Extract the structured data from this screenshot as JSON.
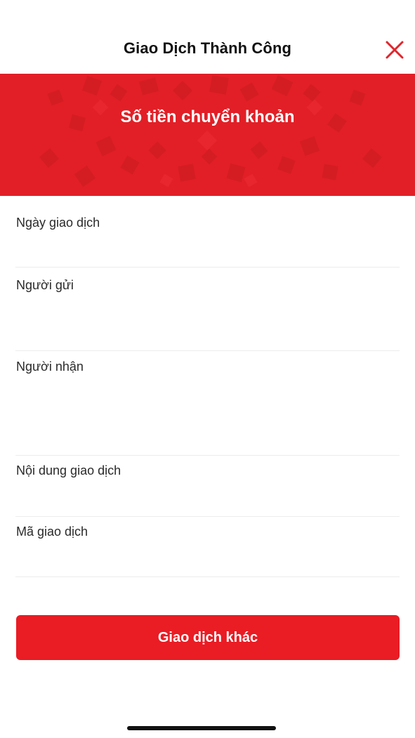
{
  "header": {
    "title": "Giao Dịch Thành Công",
    "close_icon": "close-icon"
  },
  "banner": {
    "title": "Số tiền chuyển khoản",
    "color": "#e21f26"
  },
  "details": {
    "date_label": "Ngày giao dịch",
    "sender_label": "Người gửi",
    "receiver_label": "Người nhận",
    "content_label": "Nội dung giao dịch",
    "txid_label": "Mã giao dịch"
  },
  "actions": {
    "other_transaction_label": "Giao dịch khác",
    "button_color": "#ea1c24"
  }
}
